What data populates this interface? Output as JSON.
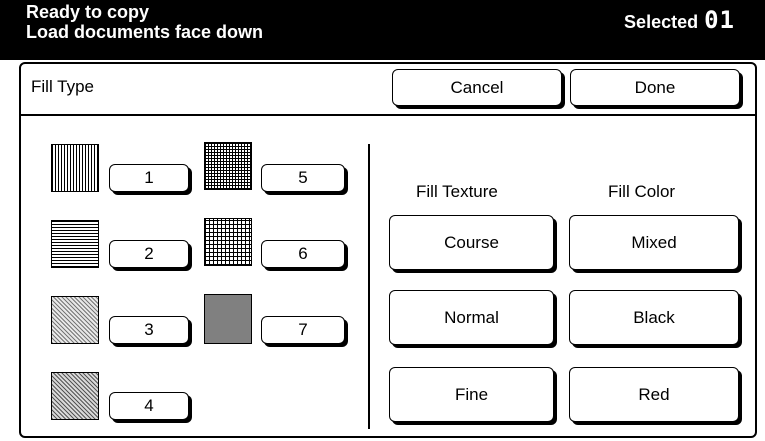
{
  "status": {
    "line1": "Ready to copy",
    "line2": "Load documents face down",
    "selected_label": "Selected",
    "selected_value": "01"
  },
  "dialog": {
    "title": "Fill Type",
    "cancel_label": "Cancel",
    "done_label": "Done"
  },
  "patterns": [
    {
      "label": "1",
      "pattern": "vertical-lines"
    },
    {
      "label": "2",
      "pattern": "horizontal-lines"
    },
    {
      "label": "3",
      "pattern": "diagonal-light"
    },
    {
      "label": "4",
      "pattern": "diagonal-dense"
    },
    {
      "label": "5",
      "pattern": "crosshatch"
    },
    {
      "label": "6",
      "pattern": "crosshatch-fine"
    },
    {
      "label": "7",
      "pattern": "solid-gray"
    }
  ],
  "fill_texture": {
    "heading": "Fill Texture",
    "options": [
      "Course",
      "Normal",
      "Fine"
    ]
  },
  "fill_color": {
    "heading": "Fill Color",
    "options": [
      "Mixed",
      "Black",
      "Red"
    ]
  }
}
